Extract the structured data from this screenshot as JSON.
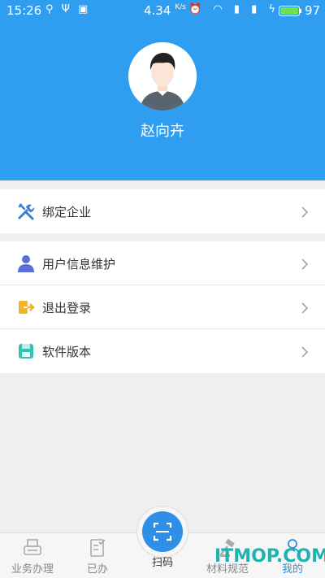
{
  "status_bar": {
    "time": "15:26",
    "net_speed": "4.34",
    "net_speed_unit": "K/s",
    "battery": "97"
  },
  "profile": {
    "name": "赵向卉"
  },
  "menu": {
    "group1": [
      {
        "label": "绑定企业",
        "icon": "wrench-screwdriver-icon"
      }
    ],
    "group2": [
      {
        "label": "用户信息维护",
        "icon": "user-icon"
      },
      {
        "label": "退出登录",
        "icon": "logout-icon"
      },
      {
        "label": "软件版本",
        "icon": "save-icon"
      }
    ]
  },
  "nav": {
    "items": [
      {
        "label": "业务办理",
        "icon": "printer-icon"
      },
      {
        "label": "已办",
        "icon": "checklist-icon"
      },
      {
        "label": "扫码",
        "icon": "scan-icon"
      },
      {
        "label": "材料规范",
        "icon": "gavel-icon"
      },
      {
        "label": "我的",
        "icon": "person-icon"
      }
    ]
  },
  "watermark": "ITMOP.COM",
  "colors": {
    "primary": "#2f9df0",
    "scan": "#2f8ee6",
    "active_nav": "#2f8ee6",
    "watermark": "#1fb3b0"
  }
}
